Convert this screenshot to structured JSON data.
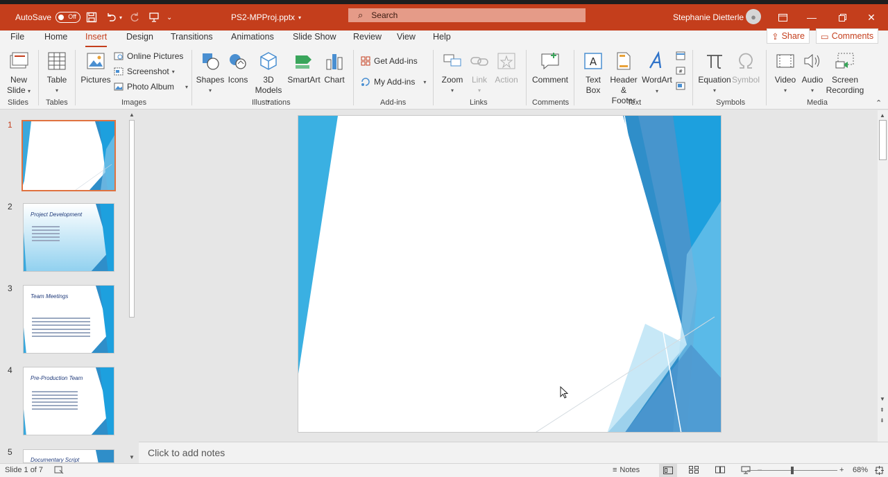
{
  "titlebar": {
    "autosave_label": "AutoSave",
    "autosave_state": "Off",
    "filename": "PS2-MPProj.pptx",
    "search_placeholder": "Search",
    "user_name": "Stephanie Dietterle"
  },
  "tabs": [
    "File",
    "Home",
    "Insert",
    "Design",
    "Transitions",
    "Animations",
    "Slide Show",
    "Review",
    "View",
    "Help"
  ],
  "active_tab": "Insert",
  "share_label": "Share",
  "comments_label": "Comments",
  "ribbon": {
    "new_slide": "New",
    "new_slide_2": "Slide",
    "table": "Table",
    "pictures": "Pictures",
    "online_pictures": "Online Pictures",
    "screenshot": "Screenshot",
    "photo_album": "Photo Album",
    "shapes": "Shapes",
    "icons": "Icons",
    "models_3d": "3D",
    "models_3d_2": "Models",
    "smartart": "SmartArt",
    "chart": "Chart",
    "get_addins": "Get Add-ins",
    "my_addins": "My Add-ins",
    "zoom": "Zoom",
    "link": "Link",
    "action": "Action",
    "comment": "Comment",
    "text_box": "Text",
    "text_box_2": "Box",
    "header_footer": "Header",
    "header_footer_2": "& Footer",
    "wordart": "WordArt",
    "equation": "Equation",
    "symbol": "Symbol",
    "video": "Video",
    "audio": "Audio",
    "screen_recording": "Screen",
    "screen_recording_2": "Recording",
    "groups": {
      "slides": "Slides",
      "tables": "Tables",
      "images": "Images",
      "illustrations": "Illustrations",
      "addins": "Add-ins",
      "links": "Links",
      "comments": "Comments",
      "text": "Text",
      "symbols": "Symbols",
      "media": "Media"
    }
  },
  "slides": [
    {
      "num": "1",
      "title": ""
    },
    {
      "num": "2",
      "title": "Project Development"
    },
    {
      "num": "3",
      "title": "Team Meetings"
    },
    {
      "num": "4",
      "title": "Pre-Production Team"
    },
    {
      "num": "5",
      "title": "Documentary Script"
    }
  ],
  "notes_placeholder": "Click to add notes",
  "status": {
    "slide_info": "Slide 1 of 7",
    "notes_btn": "Notes",
    "zoom_pct": "68%"
  },
  "colors": {
    "accent": "#c43e1c",
    "slide_blue": "#29abe2"
  }
}
